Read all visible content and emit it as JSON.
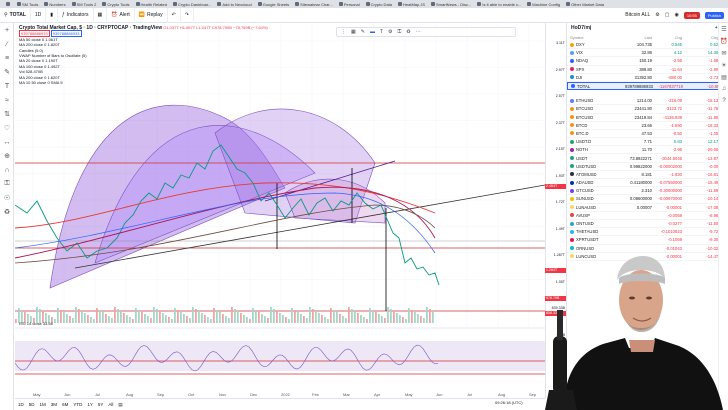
{
  "bookmarks": [
    "",
    "SM Tools",
    "Numbers",
    "SM Tools 2",
    "Crypto Tools",
    "Health Related",
    "Crypto Dashboar...",
    "Add to Nexcloud",
    "Google Sheets",
    "Sitewalmar Char...",
    "Personal",
    "Crypto Data",
    "HeatMap.JS",
    "SmartNews - Disc...",
    "Is it able to enable c...",
    "Machine Config",
    "Other Market Data"
  ],
  "toolbar": {
    "symbol": "TOTAL",
    "interval": "1D",
    "indicators": "Indicators",
    "alert": "Alert",
    "replay": "Replay",
    "layout": "Bitcoin ALL",
    "rec": "10:55",
    "publish": "Publish"
  },
  "legend": {
    "title": "Crypto Total Market Cap, $ · 1D · CRYPTOCAP · TradingView",
    "ohlc": "O1.037T H1.057T L1.047T C978.790B −78.759B (−7.64%)",
    "boxes": [
      "939788886933",
      "939788886933"
    ],
    "indicators": [
      "MA 50 close 0 1.061T",
      "MA 200 close 0 1.820T",
      "Candles (5.0)",
      "VWAP Number of Bars to Oscillate (5)",
      "MA 20 close 0 1.190T",
      "MA 100 close 0 1.492T",
      "Vol 528.470B",
      "MA 200 close 0 1.620T",
      "MA 10 50 close 0 SMA 5"
    ]
  },
  "axis_ticks": [
    "3.11T",
    "2.97T",
    "2.57T",
    "2.37T",
    "2.15T",
    "1.93T",
    "1.72T",
    "1.49T",
    "1.287T",
    "1.05T",
    "839.33B",
    "622B"
  ],
  "price_labels": [
    {
      "text": "2.464T",
      "color": "#f23645"
    },
    {
      "text": "1.284T",
      "color": "#f23645"
    },
    {
      "text": "978.79B",
      "color": "#f23645"
    },
    {
      "text": "658.33B",
      "color": "#f23645"
    }
  ],
  "x_ticks": [
    "May",
    "Jun",
    "Jul",
    "Aug",
    "Sep",
    "Oct",
    "Nov",
    "Dec",
    "2022",
    "Feb",
    "Mar",
    "Apr",
    "May",
    "Jun",
    "Jul",
    "Aug",
    "Sep"
  ],
  "rsi_label": "RSI 14 close 33.66",
  "bottom": {
    "ranges": [
      "1D",
      "5D",
      "1M",
      "3M",
      "6M",
      "YTD",
      "1Y",
      "5Y",
      "All"
    ],
    "time": "09:26:18 (UTC)"
  },
  "watchlist": {
    "title": "HoD7/mj",
    "columns": [
      "Symbol",
      "Last",
      "Chg",
      "Chg%"
    ],
    "rows": [
      {
        "sym": "DXY",
        "last": "104.735",
        "chg": "0.545",
        "pct": "0.52%",
        "color": "#f7a600",
        "dir": "pos"
      },
      {
        "sym": "VIX",
        "last": "32.86",
        "chg": "4.12",
        "pct": "14.36%",
        "color": "#5b9cf6",
        "dir": "pos"
      },
      {
        "sym": "NDAQ",
        "last": "150.19",
        "chg": "-2.56",
        "pct": "-1.68%",
        "color": "#2962ff",
        "dir": "neg"
      },
      {
        "sym": "SPX",
        "last": "389.80",
        "chg": "-11.64",
        "pct": "-2.90%",
        "color": "#e91e63",
        "dir": "neg"
      },
      {
        "sym": "DJI",
        "last": "31392.80",
        "chg": "-880.00",
        "pct": "-2.73%",
        "color": "#1e88e5",
        "dir": "neg"
      },
      {
        "sym": "TOTAL",
        "last": "939789886933",
        "chg": "-1167837719",
        "pct": "-10.88%",
        "color": "#2962ff",
        "dir": "neg",
        "selected": true
      },
      {
        "sym": "ETHUSD",
        "last": "1214.00",
        "chg": "-216.09",
        "pct": "-15.13%",
        "color": "#627eea",
        "dir": "neg"
      },
      {
        "sym": "BTCUSD",
        "last": "23441.80",
        "chg": "-3123.72",
        "pct": "-11.76%",
        "color": "#f7931a",
        "dir": "neg"
      },
      {
        "sym": "BTCUSD",
        "last": "23419.84",
        "chg": "-3136.839",
        "pct": "-11.86%",
        "color": "#f7931a",
        "dir": "neg"
      },
      {
        "sym": "BTCD",
        "last": "23.66",
        "chg": "-1.590",
        "pct": "-18.33%",
        "color": "#f7931a",
        "dir": "neg"
      },
      {
        "sym": "BTC.D",
        "last": "47.53",
        "chg": "-0.50",
        "pct": "-1.05%",
        "color": "#f7931a",
        "dir": "neg"
      },
      {
        "sym": "USDT.D",
        "last": "7.71",
        "chg": "0.83",
        "pct": "12.17%",
        "color": "#26a17b",
        "dir": "pos"
      },
      {
        "sym": "NOTH",
        "last": "11.70",
        "chg": "-2.96",
        "pct": "-20.06%",
        "color": "#9c27b0",
        "dir": "neg"
      },
      {
        "sym": "USDT",
        "last": "73.8922271",
        "chg": "-3044.8046",
        "pct": "-13.97%",
        "color": "#26a17b",
        "dir": "neg"
      },
      {
        "sym": "USDTUSD",
        "last": "0.99822000",
        "chg": "-0.00002000",
        "pct": "-0.00%",
        "color": "#26a17b",
        "dir": "neg"
      },
      {
        "sym": "ATOMUSD",
        "last": "8.181",
        "chg": "-1.630",
        "pct": "-16.61%",
        "color": "#2e3148",
        "dir": "neg"
      },
      {
        "sym": "ADAUSD",
        "last": "0.41180000",
        "chg": "-0.07550000",
        "pct": "-15.49%",
        "color": "#0033ad",
        "dir": "neg"
      },
      {
        "sym": "GTCUSD",
        "last": "2.310",
        "chg": "-0.30000000",
        "pct": "-11.59%",
        "color": "#7b3fe4",
        "dir": "neg"
      },
      {
        "sym": "SUNUSD",
        "last": "0.08600000",
        "chg": "-0.00970000",
        "pct": "-10.14%",
        "color": "#fbbc05",
        "dir": "neg"
      },
      {
        "sym": "LUNAUSD",
        "last": "0.00007",
        "chg": "-0.00001",
        "pct": "-17.08%",
        "color": "#f9d85e",
        "dir": "neg"
      },
      {
        "sym": "AVUSP",
        "last": "",
        "chg": "-0.0059",
        "pct": "-8.96%",
        "color": "#e84142",
        "dir": "neg"
      },
      {
        "sym": "ONTUSD",
        "last": "",
        "chg": "-0.0277",
        "pct": "-11.50%",
        "color": "#32a4be",
        "dir": "neg"
      },
      {
        "sym": "THETAUSD",
        "last": "",
        "chg": "-0.1010823",
        "pct": "-9.72%",
        "color": "#2ab8e6",
        "dir": "neg"
      },
      {
        "sym": "XPRTUSDT",
        "last": "",
        "chg": "-0.1059",
        "pct": "-9.30%",
        "color": "#e5184b",
        "dir": "neg"
      },
      {
        "sym": "ORNUSD",
        "last": "",
        "chg": "-0.01043",
        "pct": "-10.02%",
        "color": "#00c0c3",
        "dir": "neg"
      },
      {
        "sym": "LUNCUSD",
        "last": "",
        "chg": "-0.00001",
        "pct": "-14.47%",
        "color": "#f9d85e",
        "dir": "neg"
      }
    ]
  }
}
